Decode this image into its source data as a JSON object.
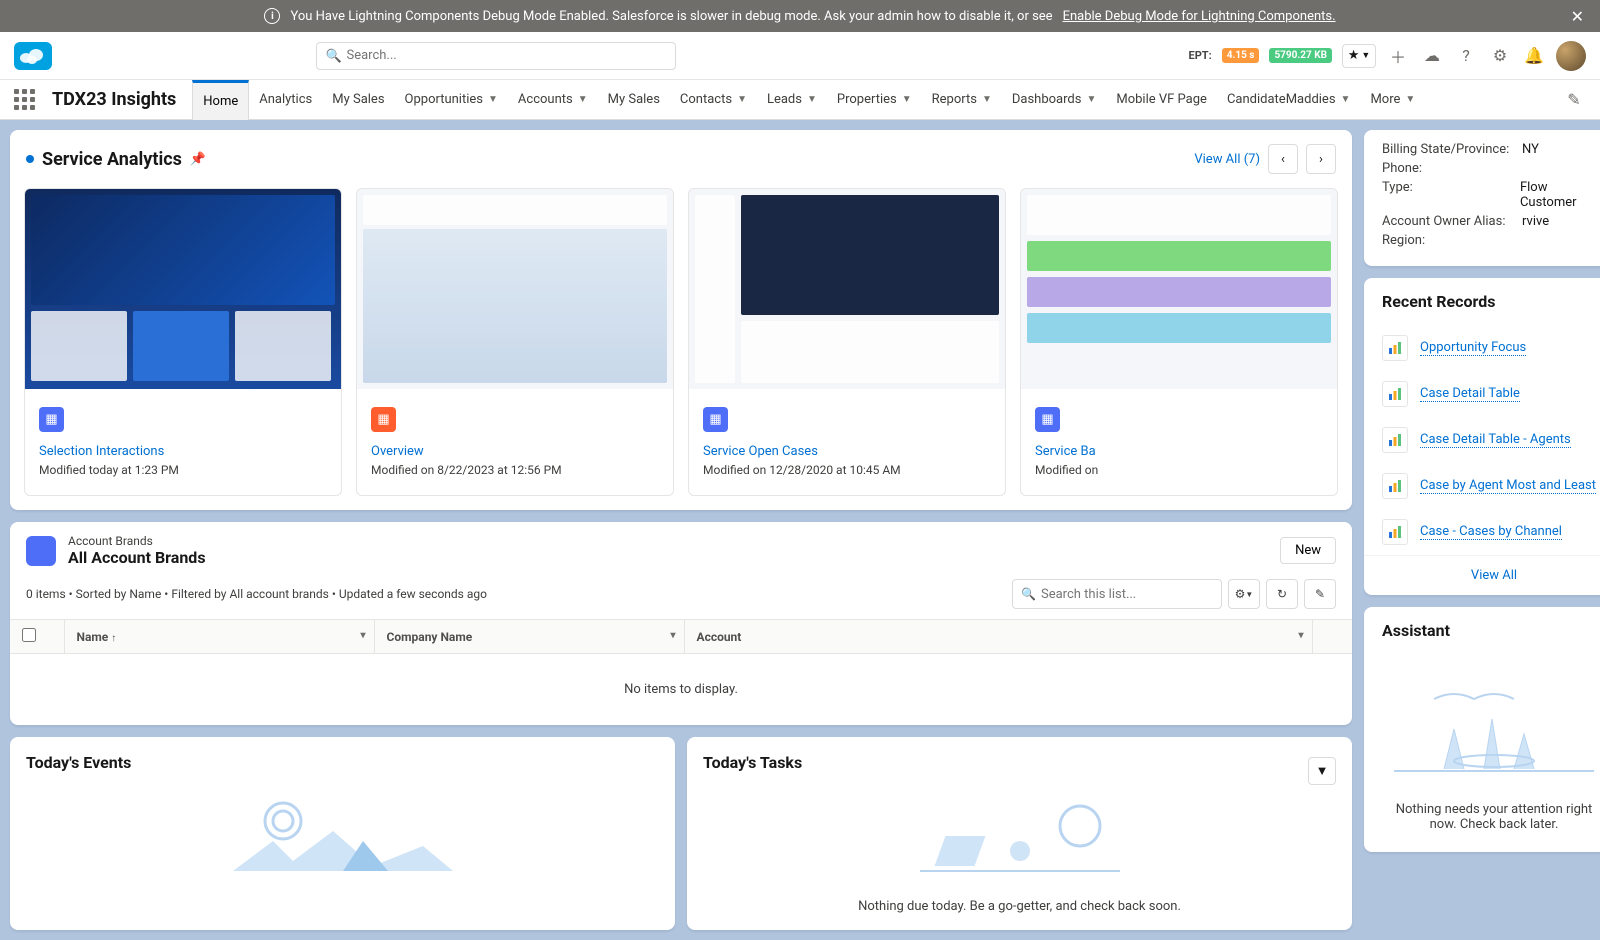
{
  "banner": {
    "text": "You Have Lightning Components Debug Mode Enabled. Salesforce is slower in debug mode. Ask your admin how to disable it, or see",
    "link": "Enable Debug Mode for Lightning Components."
  },
  "search": {
    "placeholder": "Search..."
  },
  "ept": {
    "label": "EPT:",
    "time": "4.15 s",
    "size": "5790.27 KB"
  },
  "app": {
    "name": "TDX23 Insights"
  },
  "tabs": [
    "Home",
    "Analytics",
    "My Sales",
    "Opportunities",
    "Accounts",
    "My Sales",
    "Contacts",
    "Leads",
    "Properties",
    "Reports",
    "Dashboards",
    "Mobile VF Page",
    "CandidateMaddies",
    "More"
  ],
  "tabs_has_dd": [
    false,
    false,
    false,
    true,
    true,
    false,
    true,
    true,
    true,
    true,
    true,
    false,
    true,
    true
  ],
  "sa": {
    "title": "Service Analytics",
    "viewall": "View All (7)"
  },
  "dashboards": [
    {
      "title": "Selection Interactions",
      "modified": "Modified today at 1:23 PM",
      "color": "blue",
      "previewStyle": "dark"
    },
    {
      "title": "Overview",
      "modified": "Modified on 8/22/2023 at 12:56 PM",
      "color": "orange",
      "previewStyle": "light"
    },
    {
      "title": "Service Open Cases",
      "modified": "Modified on 12/28/2020 at 10:45 AM",
      "color": "blue",
      "previewStyle": "light"
    },
    {
      "title": "Service Ba",
      "modified": "Modified on",
      "color": "blue",
      "previewStyle": "light"
    }
  ],
  "list": {
    "object": "Account Brands",
    "view": "All Account Brands",
    "newBtn": "New",
    "meta": "0 items • Sorted by Name • Filtered by All account brands • Updated a few seconds ago",
    "searchPlaceholder": "Search this list...",
    "cols": [
      "Name",
      "Company Name",
      "Account"
    ],
    "empty": "No items to display."
  },
  "events": {
    "title": "Today's Events"
  },
  "tasks": {
    "title": "Today's Tasks",
    "msg": "Nothing due today. Be a go-getter, and check back soon."
  },
  "detail": {
    "rows": [
      [
        "Billing State/Province:",
        "NY"
      ],
      [
        "Phone:",
        ""
      ],
      [
        "Type:",
        "Flow Customer"
      ],
      [
        "Account Owner Alias:",
        "rvive"
      ],
      [
        "Region:",
        ""
      ]
    ]
  },
  "recent": {
    "title": "Recent Records",
    "items": [
      "Opportunity Focus",
      "Case Detail Table",
      "Case Detail Table - Agents",
      "Case by Agent Most and Least",
      "Case - Cases by Channel"
    ],
    "viewall": "View All"
  },
  "assistant": {
    "title": "Assistant",
    "msg": "Nothing needs your attention right now. Check back later."
  }
}
